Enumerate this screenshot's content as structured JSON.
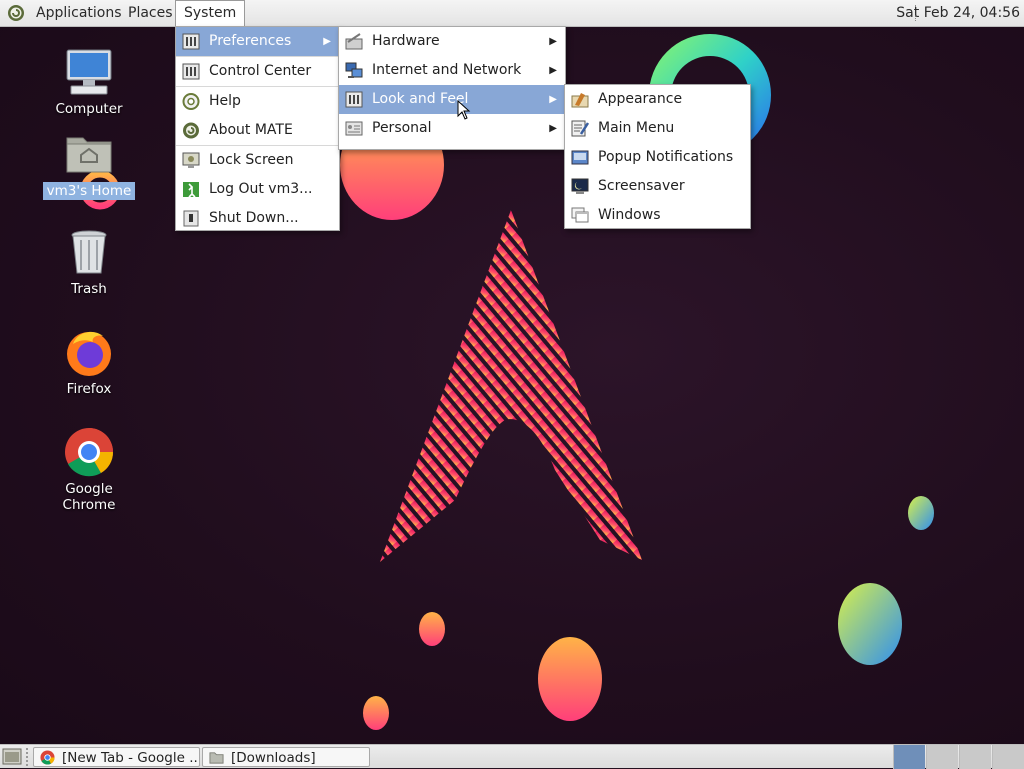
{
  "top_panel": {
    "applications_label": "Applications",
    "places_label": "Places",
    "system_label": "System",
    "clock": "Sat Feb 24, 04:56"
  },
  "desktop_icons": [
    {
      "label": "Computer",
      "icon": "computer-icon"
    },
    {
      "label": "vm3's Home",
      "icon": "home-folder-icon",
      "selected": true
    },
    {
      "label": "Trash",
      "icon": "trash-icon"
    },
    {
      "label": "Firefox",
      "icon": "firefox-icon"
    },
    {
      "label": "Google Chrome",
      "icon": "chrome-icon"
    }
  ],
  "system_menu": {
    "items": [
      {
        "label": "Preferences",
        "icon": "preferences-icon",
        "submenu": true,
        "highlighted": true
      },
      {
        "label": "Control Center",
        "icon": "control-center-icon"
      },
      {
        "label": "Help",
        "icon": "help-icon"
      },
      {
        "label": "About MATE",
        "icon": "mate-logo-icon"
      },
      {
        "label": "Lock Screen",
        "icon": "lock-screen-icon"
      },
      {
        "label": "Log Out vm3...",
        "icon": "log-out-icon"
      },
      {
        "label": "Shut Down...",
        "icon": "shut-down-icon"
      }
    ]
  },
  "preferences_menu": {
    "items": [
      {
        "label": "Hardware",
        "icon": "hardware-icon",
        "submenu": true
      },
      {
        "label": "Internet and Network",
        "icon": "network-icon",
        "submenu": true
      },
      {
        "label": "Look and Feel",
        "icon": "look-and-feel-icon",
        "submenu": true,
        "highlighted": true
      },
      {
        "label": "Personal",
        "icon": "personal-icon",
        "submenu": true
      }
    ]
  },
  "look_and_feel_menu": {
    "items": [
      {
        "label": "Appearance",
        "icon": "appearance-icon"
      },
      {
        "label": "Main Menu",
        "icon": "main-menu-icon"
      },
      {
        "label": "Popup Notifications",
        "icon": "notifications-icon"
      },
      {
        "label": "Screensaver",
        "icon": "screensaver-icon"
      },
      {
        "label": "Windows",
        "icon": "windows-icon"
      }
    ]
  },
  "taskbar": {
    "tasks": [
      {
        "label": "[New Tab - Google ...",
        "icon": "chrome-icon"
      },
      {
        "label": "[Downloads]",
        "icon": "folder-icon"
      }
    ],
    "workspaces": 4,
    "active_workspace": 1
  },
  "colors": {
    "menu_highlight": "#88a7d6",
    "wallpaper": "#200d1d"
  }
}
